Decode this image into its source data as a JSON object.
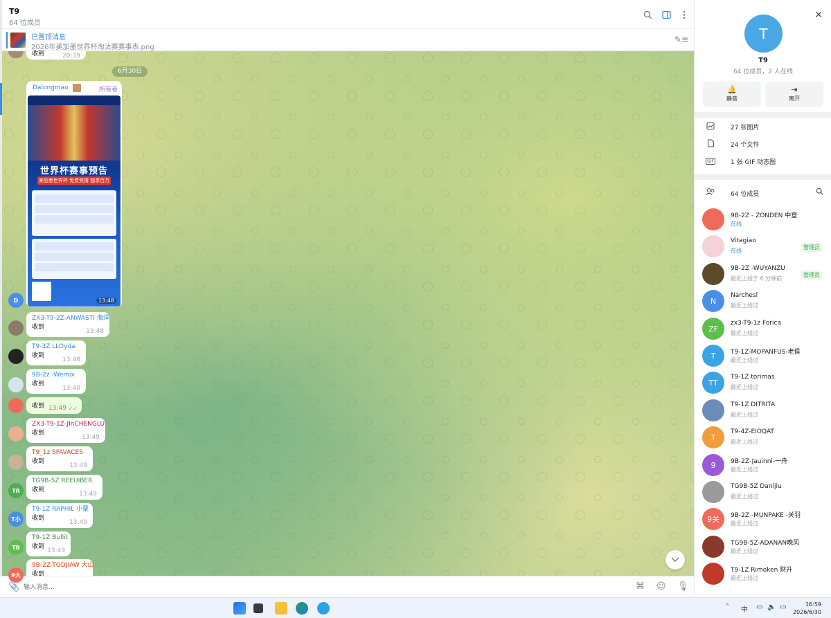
{
  "header": {
    "title": "T9",
    "subtitle": "64 位成员"
  },
  "pinned": {
    "title": "已置顶消息",
    "subtitle": "2026年美加墨世界杯淘汰赛赛事表.png"
  },
  "date_divider": "6月30日",
  "poster_msg": {
    "name": "Dalongmao",
    "role": "所有者",
    "poster_title": "世界杯赛事预告",
    "poster_sub": "美加墨世界杯 免费竞猜 独享百万",
    "time": "13:48"
  },
  "top_partial": {
    "text": "收到",
    "time": "20:39"
  },
  "messages": [
    {
      "name": "ZX3-T9-2Z-ANWASTI 海洋",
      "text": "收到",
      "time": "13:48",
      "name_color": "#2f8fd6",
      "avatar": ""
    },
    {
      "name": "T9-3Z LLOyda",
      "text": "收到",
      "time": "13:48",
      "name_color": "#2f8fd6",
      "avatar": ""
    },
    {
      "name": "9B-2z -Wemix",
      "text": "收到",
      "time": "13:48",
      "name_color": "#2f8fd6",
      "avatar": ""
    },
    {
      "name": "",
      "text": "收到",
      "time": "13:49",
      "name_color": "#2f8fd6",
      "avatar": ""
    },
    {
      "name": "ZX3-T9-1Z-JInCHENGLU",
      "text": "收到",
      "time": "13:49",
      "name_color": "#c2185b",
      "avatar": ""
    },
    {
      "name": "T9_1z SFAVACES",
      "text": "收到",
      "time": "13:49",
      "name_color": "#d84315",
      "avatar": ""
    },
    {
      "name": "TG9B-5Z REEUIBER",
      "text": "收到",
      "time": "13:49",
      "name_color": "#388e3c",
      "avatar": "TR"
    },
    {
      "name": "T9-1Z RAPHIL 小栗",
      "text": "收到",
      "time": "13:49",
      "name_color": "#2f8fd6",
      "avatar": "T小"
    },
    {
      "name": "T9-1Z Bullit",
      "text": "收到",
      "time": "13:49",
      "name_color": "#388e3c",
      "avatar": "TB"
    },
    {
      "name": "9B-2Z-TODJIAW 大山",
      "text": "收到",
      "time": "",
      "name_color": "#d84315",
      "avatar": "9大"
    }
  ],
  "side_avatar_d": "D",
  "composer": {
    "placeholder": "输入消息..."
  },
  "panel": {
    "avatar_letter": "T",
    "name": "T9",
    "subtitle": "64 位成员，2 人在线",
    "mute": "静音",
    "leave": "离开",
    "media": [
      {
        "icon": "image-icon",
        "label": "27 张图片"
      },
      {
        "icon": "file-icon",
        "label": "24 个文件"
      },
      {
        "icon": "gif-icon",
        "label": "1 张 GIF 动态图"
      }
    ],
    "gif_badge": "GIF",
    "members_header": "64 位成员",
    "members": [
      {
        "name": "9B-2Z - ZONDEN 中登",
        "status": "在线",
        "online": true,
        "role": "",
        "initials": "",
        "color": "#f06a5a"
      },
      {
        "name": "Vitagiao",
        "status": "在线",
        "online": true,
        "role": "管理员",
        "initials": "",
        "color": "#f3d2d8"
      },
      {
        "name": "9B-2Z -WUYANZU",
        "status": "最近上线于 6 分钟前",
        "online": false,
        "role": "管理员",
        "initials": "",
        "color": "#5a4a2a"
      },
      {
        "name": "Narchesl",
        "status": "最近上线过",
        "online": false,
        "role": "",
        "initials": "N",
        "color": "#4a8fe6"
      },
      {
        "name": "zx3-T9-1z Forica",
        "status": "最近上线过",
        "online": false,
        "role": "",
        "initials": "ZF",
        "color": "#5dbf4a"
      },
      {
        "name": "T9-1Z-MOPANFUS-老侯",
        "status": "最近上线过",
        "online": false,
        "role": "",
        "initials": "T",
        "color": "#3aa3e3"
      },
      {
        "name": "T9-1Z torimas",
        "status": "最近上线过",
        "online": false,
        "role": "",
        "initials": "TT",
        "color": "#3aa3e3"
      },
      {
        "name": "T9-1Z DITRITA",
        "status": "最近上线过",
        "online": false,
        "role": "",
        "initials": "",
        "color": "#6b8bb8"
      },
      {
        "name": "T9-4Z-EIOQAT",
        "status": "最近上线过",
        "online": false,
        "role": "",
        "initials": "T",
        "color": "#f39c3a"
      },
      {
        "name": "9B-2Z-Jauinni-一舟",
        "status": "最近上线过",
        "online": false,
        "role": "",
        "initials": "9",
        "color": "#9b59d6"
      },
      {
        "name": "TG9B-5Z Danijiu",
        "status": "最近上线过",
        "online": false,
        "role": "",
        "initials": "",
        "color": "#9a9a9a"
      },
      {
        "name": "9B-2Z -MUNPAKE -关羽",
        "status": "最近上线过",
        "online": false,
        "role": "",
        "initials": "9关",
        "color": "#f06a5a"
      },
      {
        "name": "TG9B-5Z-ADANAN晚风",
        "status": "最近上线过",
        "online": false,
        "role": "",
        "initials": "",
        "color": "#8a3a2a"
      },
      {
        "name": "T9-1Z Rimoken 财升",
        "status": "最近上线过",
        "online": false,
        "role": "",
        "initials": "",
        "color": "#c0392b"
      }
    ]
  },
  "taskbar": {
    "ime": "中",
    "time": "16:59",
    "date": "2026/6/30"
  },
  "colors": {
    "accent": "#3a8ee6",
    "own_bubble": "#eefcdf",
    "admin": "#4caf50"
  }
}
